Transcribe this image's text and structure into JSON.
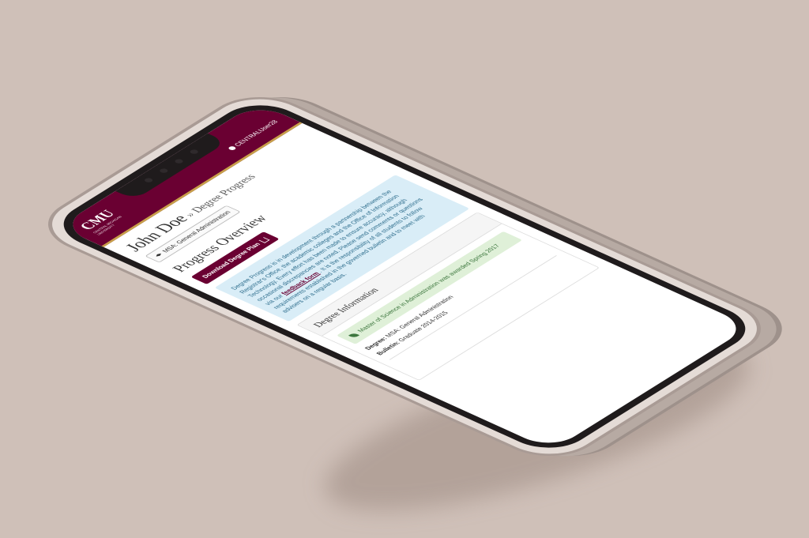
{
  "header": {
    "logo_text": "CMU",
    "logo_subtext": "CENTRAL MICHIGAN UNIVERSITY",
    "signout_label": "CENTRALUser28"
  },
  "student": {
    "name": "John Doe",
    "separator": "»",
    "page": "Degree Progress"
  },
  "program_selector": {
    "value": "MSA: General Administration"
  },
  "progress": {
    "title": "Progress Overview",
    "download_button": "Download Degree Plan",
    "info_part1": "Degree Progress is in development through a partnership between the Registrar's Office, the academic colleges and the Office of Information Technology. Every effort has been made to ensure accuracy, although occasional discrepancies are noted. Please send comments or questions via our",
    "info_link": "feedback form",
    "info_part2": ". It is the responsibility of all students to follow requirements established in the governed bulletin and to meet with advisers on a regular basis."
  },
  "degree_info": {
    "title": "Degree Information",
    "awarded_text": "Master of Science in Administration was awarded Spring 2017",
    "degree_label": "Degree:",
    "degree_value": "MSA: General Administration",
    "bulletin_label": "Bulletin:",
    "bulletin_value": "Graduate 2014-2015"
  },
  "colors": {
    "brand": "#6a0032",
    "gold": "#c8a04a",
    "info_bg": "#d9edf7",
    "success_bg": "#dff0d8"
  }
}
